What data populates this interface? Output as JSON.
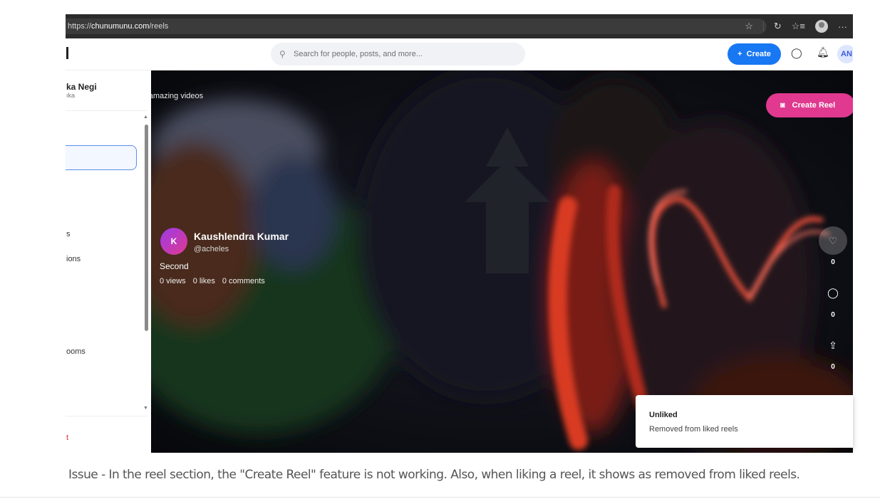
{
  "browser": {
    "url_prefix": "https://",
    "url_host": "chunumunu.com",
    "url_path": "/reels",
    "more_label": "···"
  },
  "header": {
    "search_placeholder": "Search for people, posts, and more...",
    "create_label": "Create",
    "avatar_initials": "AN"
  },
  "sidebar": {
    "user_name": "ka Negi",
    "user_handle": "ıka",
    "items": [
      {
        "label": "s"
      },
      {
        "label": "ions"
      },
      {
        "label": "ooms"
      }
    ],
    "logout_label": "t"
  },
  "reel": {
    "subtitle": "r amazing videos",
    "create_reel_label": "Create Reel",
    "author_initial": "K",
    "author_name": "Kaushlendra Kumar",
    "author_handle": "@acheles",
    "caption": "Second",
    "stats": {
      "views": "0 views",
      "likes": "0 likes",
      "comments": "0 comments"
    },
    "like_count": "0",
    "comment_count": "0",
    "share_count": "0"
  },
  "toast": {
    "title": "Unliked",
    "message": "Removed from liked reels"
  },
  "issue_text": "Issue - In the reel section, the \"Create Reel\" feature is not working. Also, when liking a reel, it shows as removed from liked reels.",
  "colors": {
    "accent_blue": "#1877f2",
    "create_reel_pink": "#e0398f",
    "logout_red": "#e03131"
  }
}
